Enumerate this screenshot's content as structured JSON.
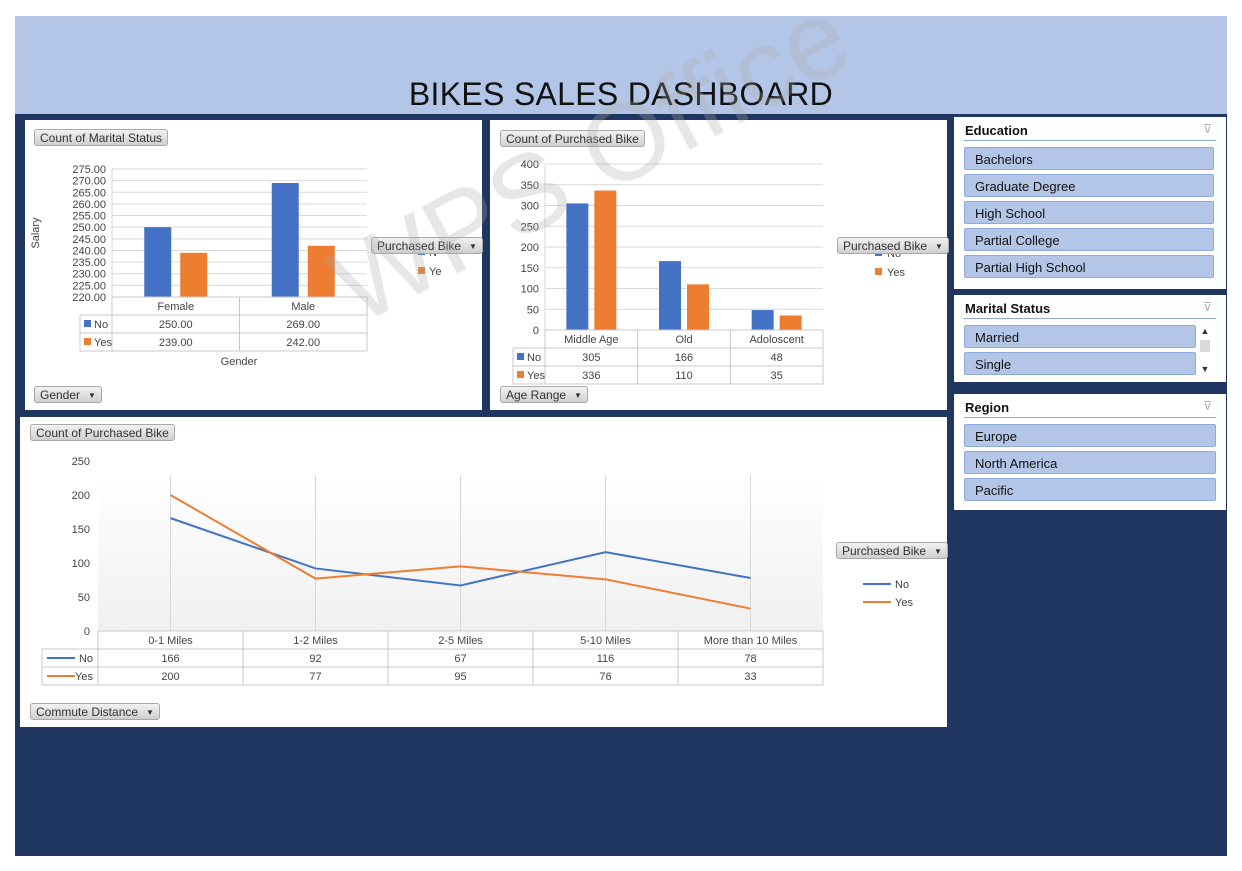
{
  "title": "BIKES SALES DASHBOARD",
  "watermark": "WPS Office",
  "colors": {
    "no": "#4472c4",
    "yes": "#ed7d31",
    "frame": "#1f3660",
    "header": "#b4c6e7",
    "slicer_item": "#b4c6e7"
  },
  "panel1": {
    "value_button": "Count of Marital Status",
    "axis_button": "Gender",
    "legend_button": "Purchased Bike",
    "legend": [
      "No",
      "Yes"
    ],
    "legend_visible": [
      "N",
      "Ye"
    ],
    "ylabel": "Salary",
    "xlabel": "Gender",
    "table": {
      "rows": [
        {
          "label": "No",
          "values": [
            "250.00",
            "269.00"
          ]
        },
        {
          "label": "Yes",
          "values": [
            "239.00",
            "242.00"
          ]
        }
      ]
    }
  },
  "panel2": {
    "value_button": "Count of Purchased Bike",
    "axis_button": "Age Range",
    "legend_button": "Purchased Bike",
    "legend": [
      "No",
      "Yes"
    ],
    "table": {
      "rows": [
        {
          "label": "No",
          "values": [
            "305",
            "166",
            "48"
          ]
        },
        {
          "label": "Yes",
          "values": [
            "336",
            "110",
            "35"
          ]
        }
      ]
    }
  },
  "panel3": {
    "value_button": "Count of Purchased Bike",
    "axis_button": "Commute Distance",
    "legend_button": "Purchased Bike",
    "legend": [
      "No",
      "Yes"
    ],
    "table": {
      "rows": [
        {
          "label": "No",
          "values": [
            "166",
            "92",
            "67",
            "116",
            "78"
          ]
        },
        {
          "label": "Yes",
          "values": [
            "200",
            "77",
            "95",
            "76",
            "33"
          ]
        }
      ]
    }
  },
  "chart_data": [
    {
      "type": "bar",
      "categories": [
        "Female",
        "Male"
      ],
      "series": [
        {
          "name": "No",
          "values": [
            250,
            269
          ]
        },
        {
          "name": "Yes",
          "values": [
            239,
            242
          ]
        }
      ],
      "ylabel": "Salary",
      "xlabel": "Gender",
      "ylim": [
        220,
        275
      ],
      "yticks": [
        "220.00",
        "225.00",
        "230.00",
        "235.00",
        "240.00",
        "245.00",
        "250.00",
        "255.00",
        "260.00",
        "265.00",
        "270.00",
        "275.00"
      ],
      "grid": true,
      "legend": "right"
    },
    {
      "type": "bar",
      "categories": [
        "Middle Age",
        "Old",
        "Adoloscent"
      ],
      "series": [
        {
          "name": "No",
          "values": [
            305,
            166,
            48
          ]
        },
        {
          "name": "Yes",
          "values": [
            336,
            110,
            35
          ]
        }
      ],
      "ylim": [
        0,
        400
      ],
      "yticks": [
        "0",
        "50",
        "100",
        "150",
        "200",
        "250",
        "300",
        "350",
        "400"
      ],
      "grid": true,
      "legend": "right"
    },
    {
      "type": "line",
      "categories": [
        "0-1 Miles",
        "1-2 Miles",
        "2-5 Miles",
        "5-10 Miles",
        "More than 10 Miles"
      ],
      "series": [
        {
          "name": "No",
          "values": [
            166,
            92,
            67,
            116,
            78
          ]
        },
        {
          "name": "Yes",
          "values": [
            200,
            77,
            95,
            76,
            33
          ]
        }
      ],
      "ylim": [
        0,
        250
      ],
      "yticks": [
        "0",
        "50",
        "100",
        "150",
        "200",
        "250"
      ],
      "grid": false,
      "legend": "right"
    }
  ],
  "slicers": {
    "education": {
      "header": "Education",
      "items": [
        "Bachelors",
        "Graduate Degree",
        "High School",
        "Partial College",
        "Partial High School"
      ]
    },
    "marital": {
      "header": "Marital Status",
      "items": [
        "Married",
        "Single"
      ]
    },
    "region": {
      "header": "Region",
      "items": [
        "Europe",
        "North America",
        "Pacific"
      ]
    }
  }
}
